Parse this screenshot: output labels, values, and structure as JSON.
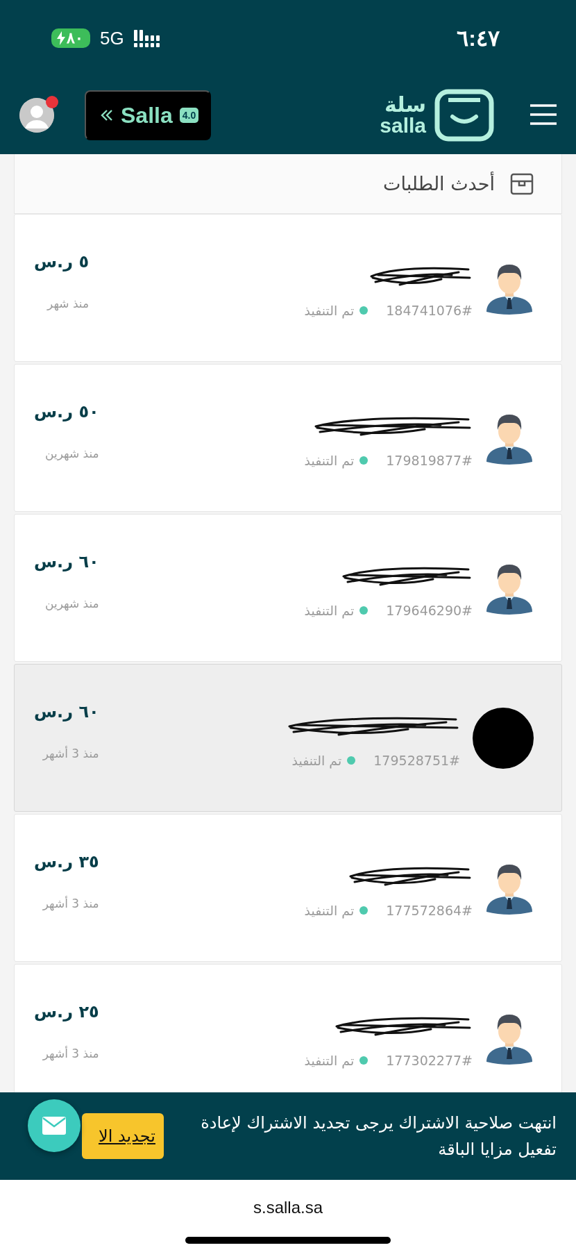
{
  "status_bar": {
    "time": "٦:٤٧",
    "network": "5G",
    "battery": "٨٠",
    "charging": true
  },
  "header": {
    "version_badge": {
      "name": "Salla",
      "version": "4.0"
    },
    "logo": {
      "arabic": "سلة",
      "latin": "salla"
    },
    "notification": true
  },
  "orders": {
    "title": "أحدث الطلبات",
    "rows": [
      {
        "kind": "person",
        "number": "184741076#",
        "status": "تم التنفيذ",
        "amount": "٥ ر.س",
        "time": "منذ شهر",
        "selected": false
      },
      {
        "kind": "person",
        "number": "179819877#",
        "status": "تم التنفيذ",
        "amount": "٥٠ ر.س",
        "time": "منذ شهرين",
        "selected": false
      },
      {
        "kind": "person",
        "number": "179646290#",
        "status": "تم التنفيذ",
        "amount": "٦٠ ر.س",
        "time": "منذ شهرين",
        "selected": false
      },
      {
        "kind": "redacted",
        "number": "179528751#",
        "status": "تم التنفيذ",
        "amount": "٦٠ ر.س",
        "time": "منذ 3 أشهر",
        "selected": true
      },
      {
        "kind": "person",
        "number": "177572864#",
        "status": "تم التنفيذ",
        "amount": "٣٥ ر.س",
        "time": "منذ 3 أشهر",
        "selected": false
      },
      {
        "kind": "person",
        "number": "177302277#",
        "status": "تم التنفيذ",
        "amount": "٢٥ ر.س",
        "time": "منذ 3 أشهر",
        "selected": false
      }
    ]
  },
  "banner": {
    "message": "انتهت صلاحية الاشتراك يرجى تجديد الاشتراك لإعادة تفعيل مزايا الباقة",
    "button": "تجديد الا"
  },
  "url_bar": {
    "address": "s.salla.sa"
  }
}
